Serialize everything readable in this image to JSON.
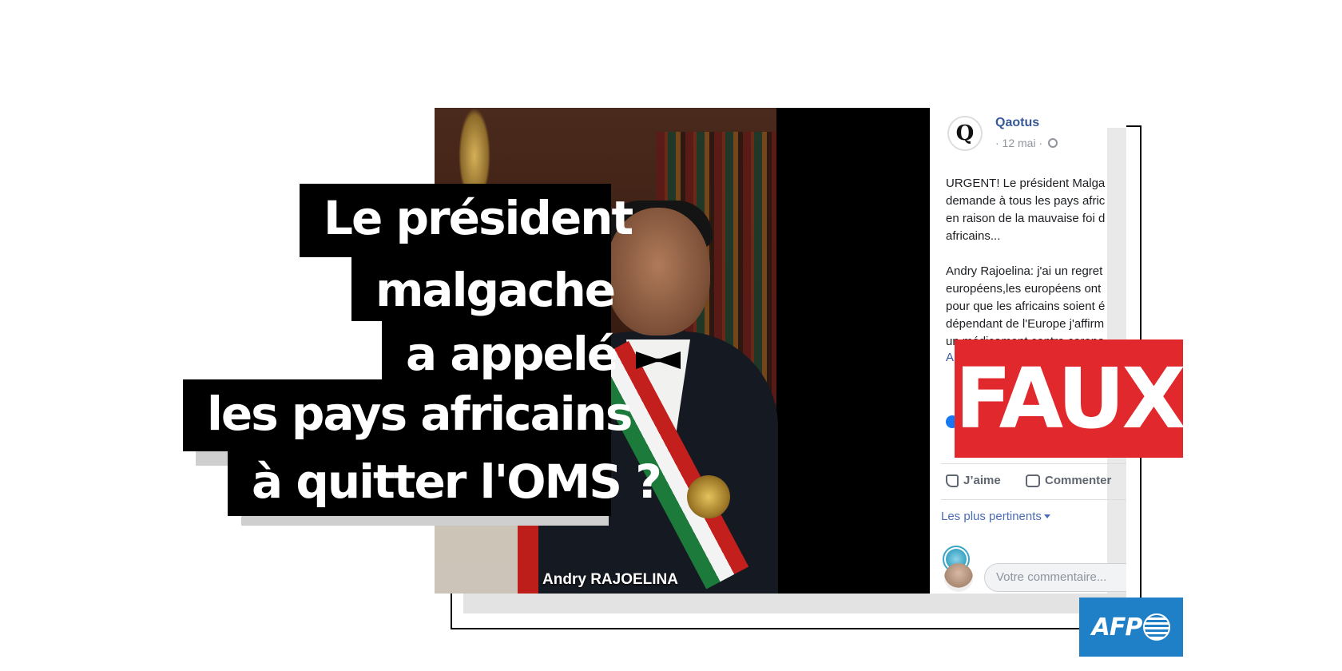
{
  "headline": {
    "lines": [
      "Le président",
      "malgache",
      "a appelé",
      "les pays africains",
      "à quitter l'OMS ?"
    ]
  },
  "photo": {
    "caption": "Andry RAJOELINA"
  },
  "post": {
    "page_name": "Qaotus",
    "meta": "· 12 mai ·",
    "text_lines": [
      "URGENT! Le président Malga",
      "demande à tous les pays afric",
      "en raison de la mauvaise foi d",
      "africains...",
      "",
      "Andry Rajoelina: j'ai un regret",
      "européens,les européens ont",
      "pour que les africains soient é",
      "dépendant de l'Europe j'affirm",
      "un médicament contre corona"
    ],
    "more_link": "A",
    "like_label": "J’aime",
    "comment_label": "Commenter",
    "sort_label": "Les plus pertinents",
    "comment_placeholder": "Votre commentaire..."
  },
  "verdict": {
    "label": "FAUX",
    "color": "#e1282c"
  },
  "logo": {
    "label": "AFP",
    "color": "#1f7fc7"
  }
}
